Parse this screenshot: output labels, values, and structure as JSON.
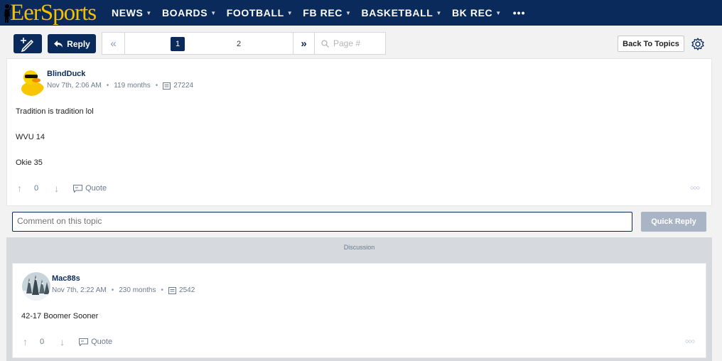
{
  "site": {
    "logo_text": "EerSports"
  },
  "nav": {
    "items": [
      {
        "label": "NEWS"
      },
      {
        "label": "BOARDS"
      },
      {
        "label": "FOOTBALL"
      },
      {
        "label": "FB REC"
      },
      {
        "label": "BASKETBALL"
      },
      {
        "label": "BK REC"
      }
    ],
    "more": "•••"
  },
  "toolbar": {
    "reply_label": "Reply",
    "pages": [
      "1",
      "2"
    ],
    "current_page": "1",
    "page_placeholder": "Page #",
    "back_label": "Back To Topics"
  },
  "posts": [
    {
      "username": "BlindDuck",
      "date": "Nov 7th, 2:06 AM",
      "tenure": "119 months",
      "post_count": "27224",
      "lines": [
        "Tradition is tradition lol",
        "WVU 14",
        "Okie 35"
      ],
      "votes": "0",
      "quote_label": "Quote"
    },
    {
      "username": "Mac88s",
      "date": "Nov 7th, 2:22 AM",
      "tenure": "230 months",
      "post_count": "2542",
      "lines": [
        "42-17 Boomer Sooner"
      ],
      "votes": "0",
      "quote_label": "Quote"
    }
  ],
  "reply": {
    "placeholder": "Comment on this topic",
    "button_label": "Quick Reply"
  },
  "discussion_label": "Discussion",
  "colors": {
    "brand_navy": "#0b2a5c",
    "brand_gold": "#f5c000",
    "muted_button": "#a9b4c4"
  }
}
